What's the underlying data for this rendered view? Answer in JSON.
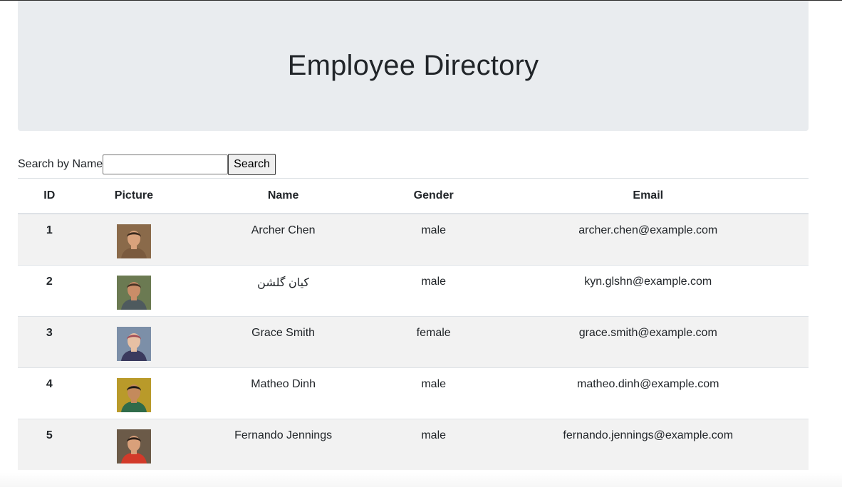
{
  "header": {
    "title": "Employee Directory"
  },
  "search": {
    "label": "Search by Name",
    "value": "",
    "placeholder": "",
    "button_label": "Search"
  },
  "table": {
    "columns": [
      "ID",
      "Picture",
      "Name",
      "Gender",
      "Email"
    ],
    "rows": [
      {
        "id": "1",
        "name": "Archer Chen",
        "gender": "male",
        "email": "archer.chen@example.com",
        "avatar_colors": {
          "bg": "#8a6a4a",
          "skin": "#d9a27c",
          "shirt": "#7a5a3e",
          "hair": "#3b2a1e"
        }
      },
      {
        "id": "2",
        "name": "کیان گلشن",
        "gender": "male",
        "email": "kyn.glshn@example.com",
        "avatar_colors": {
          "bg": "#6b7a52",
          "skin": "#c98d68",
          "shirt": "#4e5a5e",
          "hair": "#4a3526"
        }
      },
      {
        "id": "3",
        "name": "Grace Smith",
        "gender": "female",
        "email": "grace.smith@example.com",
        "avatar_colors": {
          "bg": "#7c8fa8",
          "skin": "#e7c0a4",
          "shirt": "#3a3a5e",
          "hair": "#a24e58"
        }
      },
      {
        "id": "4",
        "name": "Matheo Dinh",
        "gender": "male",
        "email": "matheo.dinh@example.com",
        "avatar_colors": {
          "bg": "#b99a2a",
          "skin": "#c48a5c",
          "shirt": "#2f6b4a",
          "hair": "#1e1a16"
        }
      },
      {
        "id": "5",
        "name": "Fernando Jennings",
        "gender": "male",
        "email": "fernando.jennings@example.com",
        "avatar_colors": {
          "bg": "#6b5a48",
          "skin": "#d9a07a",
          "shirt": "#d23a2a",
          "hair": "#2a1f18"
        }
      }
    ]
  }
}
